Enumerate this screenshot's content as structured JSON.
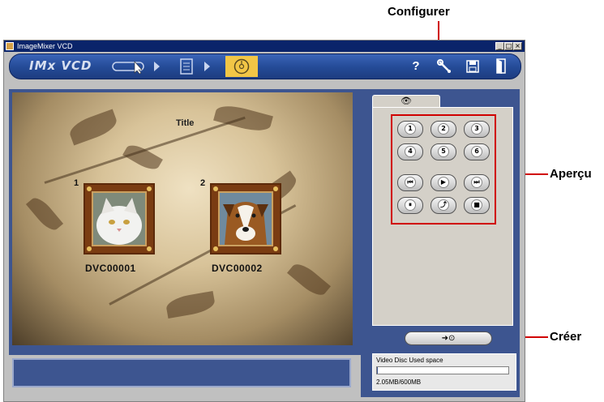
{
  "callouts": {
    "configurer": "Configurer",
    "apercu": "Aperçu",
    "creer": "Créer"
  },
  "window": {
    "title": "ImageMixer VCD",
    "controls": [
      "_",
      "□",
      "×"
    ]
  },
  "toolbar": {
    "logo": "IMx VCD",
    "steps": [
      {
        "name": "capture",
        "icon": "capture-cursor-icon"
      },
      {
        "name": "edit",
        "icon": "list-page-icon"
      },
      {
        "name": "create",
        "icon": "disc-create-icon",
        "active": true
      }
    ],
    "help_label": "?",
    "tools": [
      "help-icon",
      "configure-wrench-icon",
      "save-floppy-icon",
      "exit-door-icon"
    ],
    "active_color": "#f2c646"
  },
  "preview": {
    "menu_title": "Title",
    "items": [
      {
        "number": "1",
        "label": "DVC00001",
        "thumb": "white cat"
      },
      {
        "number": "2",
        "label": "DVC00002",
        "thumb": "collie dog"
      }
    ]
  },
  "panel": {
    "tab_icon": "eye-icon",
    "tab_label": "👁",
    "number_buttons": [
      "1",
      "2",
      "3",
      "4",
      "5",
      "6"
    ],
    "transport_buttons": [
      {
        "label": "⏮",
        "icon": "previous-icon"
      },
      {
        "label": "▶",
        "icon": "play-icon"
      },
      {
        "label": "⏭",
        "icon": "next-icon"
      },
      {
        "label": "⏸",
        "icon": "pause-icon"
      },
      {
        "label": "⤴",
        "icon": "return-icon"
      },
      {
        "label": "■",
        "icon": "stop-icon"
      }
    ],
    "create_label": "➜⊙",
    "disc": {
      "label": "Video Disc   Used space",
      "size_text": "2.05MB/600MB",
      "used_fraction": 0.0034
    }
  }
}
